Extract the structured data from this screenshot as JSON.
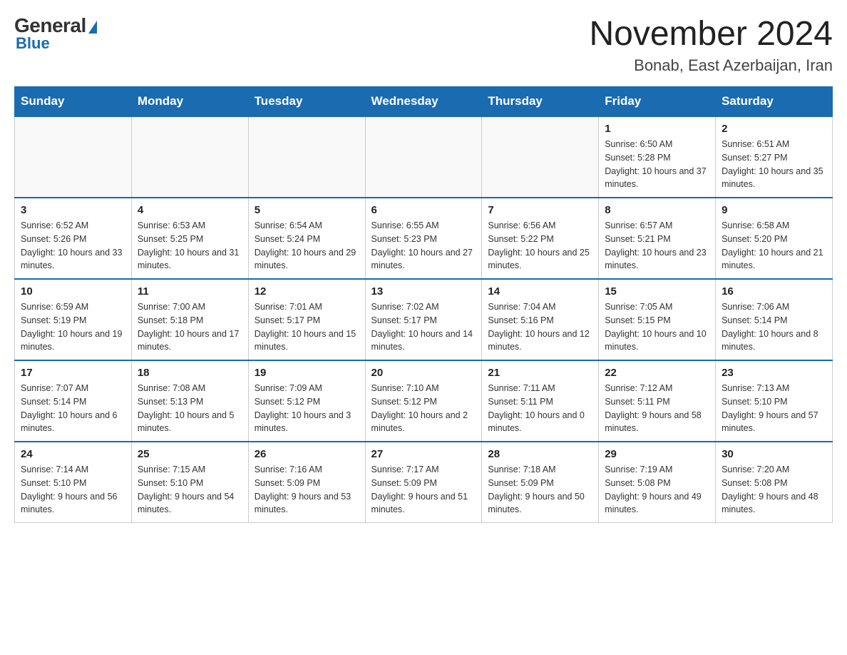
{
  "header": {
    "logo_general": "General",
    "logo_blue": "Blue",
    "month_title": "November 2024",
    "location": "Bonab, East Azerbaijan, Iran"
  },
  "days_of_week": [
    "Sunday",
    "Monday",
    "Tuesday",
    "Wednesday",
    "Thursday",
    "Friday",
    "Saturday"
  ],
  "weeks": [
    [
      {
        "day": "",
        "info": ""
      },
      {
        "day": "",
        "info": ""
      },
      {
        "day": "",
        "info": ""
      },
      {
        "day": "",
        "info": ""
      },
      {
        "day": "",
        "info": ""
      },
      {
        "day": "1",
        "info": "Sunrise: 6:50 AM\nSunset: 5:28 PM\nDaylight: 10 hours and 37 minutes."
      },
      {
        "day": "2",
        "info": "Sunrise: 6:51 AM\nSunset: 5:27 PM\nDaylight: 10 hours and 35 minutes."
      }
    ],
    [
      {
        "day": "3",
        "info": "Sunrise: 6:52 AM\nSunset: 5:26 PM\nDaylight: 10 hours and 33 minutes."
      },
      {
        "day": "4",
        "info": "Sunrise: 6:53 AM\nSunset: 5:25 PM\nDaylight: 10 hours and 31 minutes."
      },
      {
        "day": "5",
        "info": "Sunrise: 6:54 AM\nSunset: 5:24 PM\nDaylight: 10 hours and 29 minutes."
      },
      {
        "day": "6",
        "info": "Sunrise: 6:55 AM\nSunset: 5:23 PM\nDaylight: 10 hours and 27 minutes."
      },
      {
        "day": "7",
        "info": "Sunrise: 6:56 AM\nSunset: 5:22 PM\nDaylight: 10 hours and 25 minutes."
      },
      {
        "day": "8",
        "info": "Sunrise: 6:57 AM\nSunset: 5:21 PM\nDaylight: 10 hours and 23 minutes."
      },
      {
        "day": "9",
        "info": "Sunrise: 6:58 AM\nSunset: 5:20 PM\nDaylight: 10 hours and 21 minutes."
      }
    ],
    [
      {
        "day": "10",
        "info": "Sunrise: 6:59 AM\nSunset: 5:19 PM\nDaylight: 10 hours and 19 minutes."
      },
      {
        "day": "11",
        "info": "Sunrise: 7:00 AM\nSunset: 5:18 PM\nDaylight: 10 hours and 17 minutes."
      },
      {
        "day": "12",
        "info": "Sunrise: 7:01 AM\nSunset: 5:17 PM\nDaylight: 10 hours and 15 minutes."
      },
      {
        "day": "13",
        "info": "Sunrise: 7:02 AM\nSunset: 5:17 PM\nDaylight: 10 hours and 14 minutes."
      },
      {
        "day": "14",
        "info": "Sunrise: 7:04 AM\nSunset: 5:16 PM\nDaylight: 10 hours and 12 minutes."
      },
      {
        "day": "15",
        "info": "Sunrise: 7:05 AM\nSunset: 5:15 PM\nDaylight: 10 hours and 10 minutes."
      },
      {
        "day": "16",
        "info": "Sunrise: 7:06 AM\nSunset: 5:14 PM\nDaylight: 10 hours and 8 minutes."
      }
    ],
    [
      {
        "day": "17",
        "info": "Sunrise: 7:07 AM\nSunset: 5:14 PM\nDaylight: 10 hours and 6 minutes."
      },
      {
        "day": "18",
        "info": "Sunrise: 7:08 AM\nSunset: 5:13 PM\nDaylight: 10 hours and 5 minutes."
      },
      {
        "day": "19",
        "info": "Sunrise: 7:09 AM\nSunset: 5:12 PM\nDaylight: 10 hours and 3 minutes."
      },
      {
        "day": "20",
        "info": "Sunrise: 7:10 AM\nSunset: 5:12 PM\nDaylight: 10 hours and 2 minutes."
      },
      {
        "day": "21",
        "info": "Sunrise: 7:11 AM\nSunset: 5:11 PM\nDaylight: 10 hours and 0 minutes."
      },
      {
        "day": "22",
        "info": "Sunrise: 7:12 AM\nSunset: 5:11 PM\nDaylight: 9 hours and 58 minutes."
      },
      {
        "day": "23",
        "info": "Sunrise: 7:13 AM\nSunset: 5:10 PM\nDaylight: 9 hours and 57 minutes."
      }
    ],
    [
      {
        "day": "24",
        "info": "Sunrise: 7:14 AM\nSunset: 5:10 PM\nDaylight: 9 hours and 56 minutes."
      },
      {
        "day": "25",
        "info": "Sunrise: 7:15 AM\nSunset: 5:10 PM\nDaylight: 9 hours and 54 minutes."
      },
      {
        "day": "26",
        "info": "Sunrise: 7:16 AM\nSunset: 5:09 PM\nDaylight: 9 hours and 53 minutes."
      },
      {
        "day": "27",
        "info": "Sunrise: 7:17 AM\nSunset: 5:09 PM\nDaylight: 9 hours and 51 minutes."
      },
      {
        "day": "28",
        "info": "Sunrise: 7:18 AM\nSunset: 5:09 PM\nDaylight: 9 hours and 50 minutes."
      },
      {
        "day": "29",
        "info": "Sunrise: 7:19 AM\nSunset: 5:08 PM\nDaylight: 9 hours and 49 minutes."
      },
      {
        "day": "30",
        "info": "Sunrise: 7:20 AM\nSunset: 5:08 PM\nDaylight: 9 hours and 48 minutes."
      }
    ]
  ]
}
